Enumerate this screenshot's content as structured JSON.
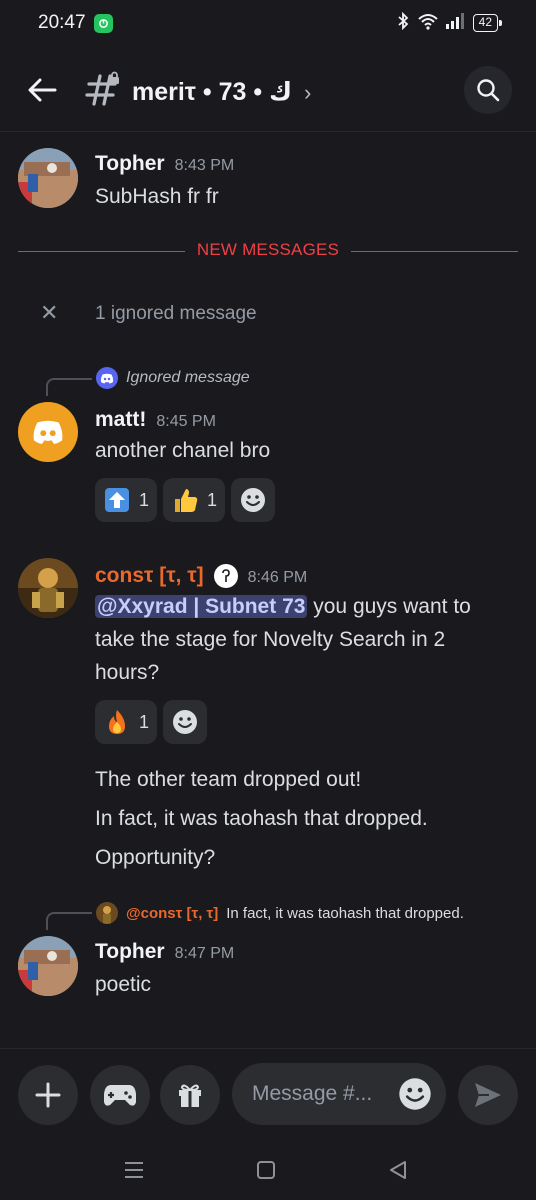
{
  "status_bar": {
    "time": "20:47",
    "battery": "42"
  },
  "header": {
    "channel_name": "meriτ • 73 • ك"
  },
  "new_messages_label": "NEW MESSAGES",
  "ignored_notice": "1 ignored message",
  "messages": [
    {
      "author": "Topher",
      "time": "8:43 PM",
      "text": "SubHash fr fr"
    },
    {
      "reply_preview": "Ignored message",
      "author": "matt!",
      "time": "8:45 PM",
      "text": "another chanel bro",
      "reactions": [
        {
          "emoji": "up-arrow",
          "count": "1"
        },
        {
          "emoji": "thumbs-up",
          "count": "1"
        }
      ]
    },
    {
      "author": "consτ [τ, τ]",
      "time": "8:46 PM",
      "mention": "@Xxyrad | Subnet 73",
      "text_line1_rest": " you guys want to",
      "text_line2": "take the stage for Novelty Search in 2",
      "text_line3": "hours?",
      "reactions": [
        {
          "emoji": "fire",
          "count": "1"
        }
      ],
      "followups": [
        "The other team dropped out!",
        "In fact, it was taohash that dropped.",
        "Opportunity?"
      ]
    },
    {
      "reply_author": "@consτ [τ, τ]",
      "reply_text": "In fact, it was taohash that dropped.",
      "author": "Topher",
      "time": "8:47 PM",
      "text": "poetic"
    }
  ],
  "composer": {
    "placeholder": "Message #..."
  }
}
